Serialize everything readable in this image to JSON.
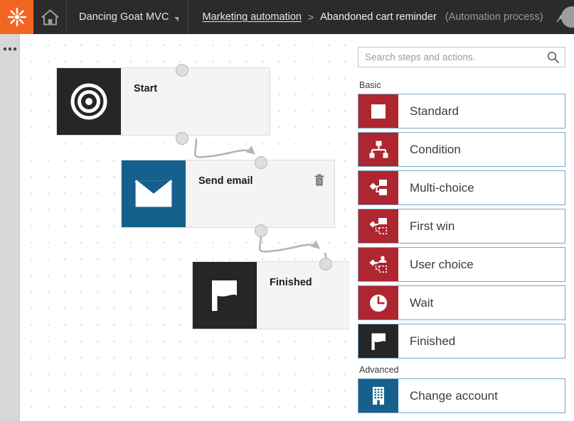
{
  "topbar": {
    "logo_icon": "kentico-asterisk-logo",
    "home_icon": "home-icon",
    "site_name": "Dancing Goat MVC",
    "site_caret_icon": "caret-down-icon",
    "breadcrumb": {
      "link": "Marketing automation",
      "separator": ">",
      "current": "Abandoned cart reminder",
      "type": "(Automation process)"
    },
    "pin_icon": "pin-icon",
    "avatar_icon": "user-avatar"
  },
  "rail": {
    "menu_icon": "ellipsis-menu-icon"
  },
  "canvas": {
    "nodes": [
      {
        "title": "Start",
        "icon": "target-bullseye-icon",
        "icon_color": "#262626"
      },
      {
        "title": "Send email",
        "icon": "envelope-icon",
        "icon_color": "#16608e",
        "delete_icon": "trash-icon"
      },
      {
        "title": "Finished",
        "icon": "flag-icon",
        "icon_color": "#262626"
      }
    ]
  },
  "panel": {
    "search": {
      "placeholder": "Search steps and actions.",
      "value": "",
      "icon": "search-icon"
    },
    "groups": [
      {
        "label": "Basic",
        "steps": [
          {
            "label": "Standard",
            "icon": "square-icon",
            "color": "#ad2630"
          },
          {
            "label": "Condition",
            "icon": "hierarchy-icon",
            "color": "#ad2630"
          },
          {
            "label": "Multi-choice",
            "icon": "multi-choice-icon",
            "color": "#ad2630"
          },
          {
            "label": "First win",
            "icon": "first-win-icon",
            "color": "#ad2630"
          },
          {
            "label": "User choice",
            "icon": "user-choice-icon",
            "color": "#ad2630"
          },
          {
            "label": "Wait",
            "icon": "clock-icon",
            "color": "#ad2630"
          },
          {
            "label": "Finished",
            "icon": "flag-icon",
            "color": "#262626"
          }
        ]
      },
      {
        "label": "Advanced",
        "steps": [
          {
            "label": "Change account",
            "icon": "building-icon",
            "color": "#16608e"
          }
        ]
      }
    ]
  },
  "colors": {
    "brand_orange": "#f26522",
    "topbar_dark": "#2b2b2b",
    "accent_red": "#ad2630",
    "accent_blue": "#16608e",
    "node_dark": "#262626",
    "grid_dot": "#ccd9e4"
  }
}
